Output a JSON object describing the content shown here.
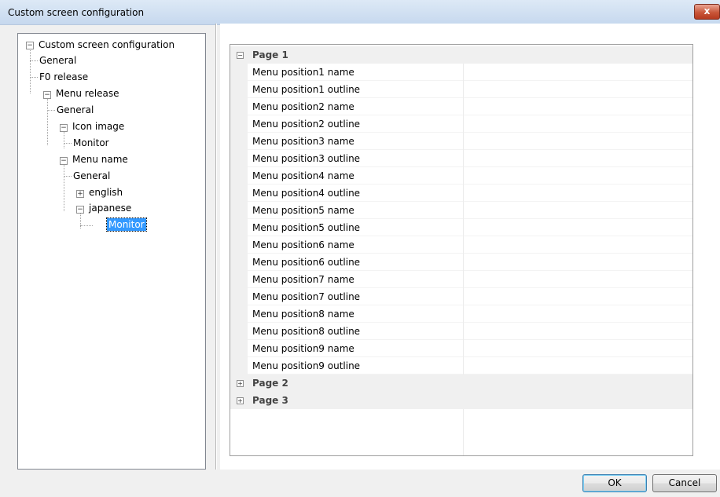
{
  "window": {
    "title": "Custom screen configuration",
    "close_glyph": "x"
  },
  "tree": {
    "root": "Custom screen configuration",
    "general": "General",
    "f0_release": "F0 release",
    "menu_release": "Menu release",
    "menu_release_general": "General",
    "icon_image": "Icon image",
    "icon_image_monitor": "Monitor",
    "menu_name": "Menu name",
    "menu_name_general": "General",
    "english": "english",
    "japanese": "japanese",
    "japanese_monitor": "Monitor"
  },
  "grid": {
    "page1": "Page 1",
    "page2": "Page 2",
    "page3": "Page 3",
    "properties": [
      "Menu position1 name",
      "Menu position1 outline",
      "Menu position2 name",
      "Menu position2 outline",
      "Menu position3 name",
      "Menu position3 outline",
      "Menu position4 name",
      "Menu position4 outline",
      "Menu position5 name",
      "Menu position5 outline",
      "Menu position6 name",
      "Menu position6 outline",
      "Menu position7 name",
      "Menu position7 outline",
      "Menu position8 name",
      "Menu position8 outline",
      "Menu position9 name",
      "Menu position9 outline"
    ]
  },
  "buttons": {
    "ok": "OK",
    "cancel": "Cancel"
  },
  "colors": {
    "selection": "#3399ff",
    "close_button": "#c95639"
  }
}
